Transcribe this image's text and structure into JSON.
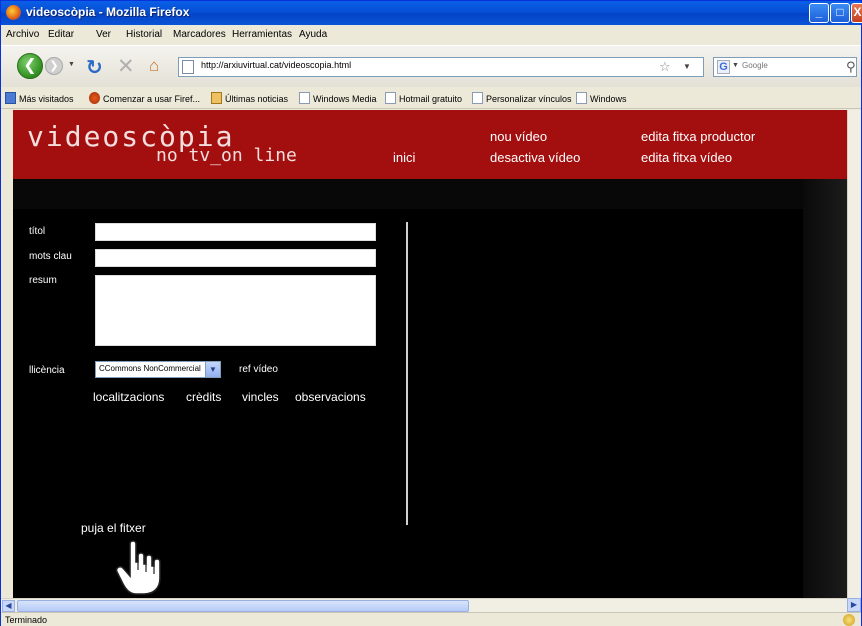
{
  "window": {
    "title": "videoscòpia - Mozilla Firefox",
    "minimize": "_",
    "maximize": "□",
    "close": "X"
  },
  "menubar": {
    "items": [
      {
        "label": "Archivo"
      },
      {
        "label": "Editar"
      },
      {
        "label": "Ver"
      },
      {
        "label": "Historial"
      },
      {
        "label": "Marcadores"
      },
      {
        "label": "Herramientas"
      },
      {
        "label": "Ayuda"
      }
    ]
  },
  "navbar": {
    "url": "http://arxiuvirtual.cat/videoscopia.html",
    "search_placeholder": "Google",
    "search_engine_letter": "G"
  },
  "bookmarks": [
    {
      "label": "Más visitados",
      "icon": "bookmarks-folder-icon"
    },
    {
      "label": "Comenzar a usar Firef...",
      "icon": "firefox-icon"
    },
    {
      "label": "Últimas noticias",
      "icon": "rss-news-icon"
    },
    {
      "label": "Windows Media",
      "icon": "page-icon"
    },
    {
      "label": "Hotmail gratuito",
      "icon": "page-icon"
    },
    {
      "label": "Personalizar vínculos",
      "icon": "page-icon"
    },
    {
      "label": "Windows",
      "icon": "page-icon"
    }
  ],
  "page": {
    "logo": "videoscòpia",
    "logo_sub": "no tv_on line",
    "header_links": {
      "home": "inici",
      "new_video": "nou vídeo",
      "deactivate_video": "desactiva vídeo",
      "edit_producer": "edita fitxa productor",
      "edit_video": "edita fitxa vídeo"
    },
    "form": {
      "title_label": "títol",
      "title_value": "",
      "keywords_label": "mots clau",
      "keywords_value": "",
      "summary_label": "resum",
      "summary_value": "",
      "license_label": "llicència",
      "license_value": "CCommons NonCommercial",
      "ref_label": "ref vídeo"
    },
    "sub_links": {
      "locations": "localitzacions",
      "credits": "crèdits",
      "links": "vincles",
      "observations": "observacions"
    },
    "upload_label": "puja el fitxer"
  },
  "statusbar": {
    "text": "Terminado"
  },
  "colors": {
    "header_red": "#a30f0f",
    "page_bg": "#000000",
    "xp_titlebar": "#0650d6"
  }
}
